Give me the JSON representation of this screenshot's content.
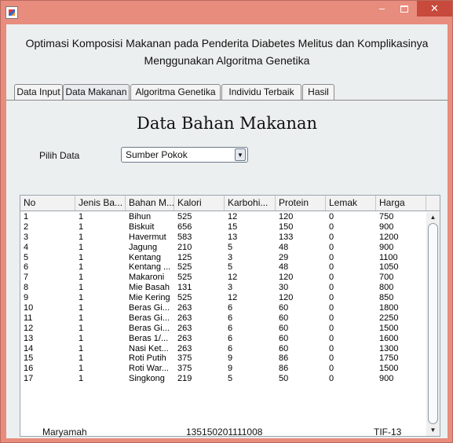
{
  "window": {
    "controls": {
      "minimize": "‒",
      "close": "✕"
    },
    "colors": {
      "titlebar": "#e88c7d",
      "close": "#c74a3c"
    }
  },
  "heading": {
    "line1": "Optimasi Komposisi Makanan pada Penderita Diabetes Melitus dan Komplikasinya",
    "line2": "Menggunakan Algoritma Genetika"
  },
  "tabs": [
    "Data Input",
    "Data Makanan",
    "Algoritma Genetika",
    "Individu Terbaik",
    "Hasil"
  ],
  "active_tab": "Data Makanan",
  "section_title": "Data Bahan Makanan",
  "filter": {
    "label": "Pilih Data",
    "selected": "Sumber Pokok"
  },
  "table": {
    "columns": [
      "No",
      "Jenis Ba...",
      "Bahan M...",
      "Kalori",
      "Karbohi...",
      "Protein",
      "Lemak",
      "Harga"
    ],
    "rows": [
      [
        "1",
        "1",
        "Bihun",
        "525",
        "12",
        "120",
        "0",
        "750"
      ],
      [
        "2",
        "1",
        "Biskuit",
        "656",
        "15",
        "150",
        "0",
        "900"
      ],
      [
        "3",
        "1",
        "Havermut",
        "583",
        "13",
        "133",
        "0",
        "1200"
      ],
      [
        "4",
        "1",
        "Jagung",
        "210",
        "5",
        "48",
        "0",
        "900"
      ],
      [
        "5",
        "1",
        "Kentang",
        "125",
        "3",
        "29",
        "0",
        "1100"
      ],
      [
        "6",
        "1",
        "Kentang ...",
        "525",
        "5",
        "48",
        "0",
        "1050"
      ],
      [
        "7",
        "1",
        "Makaroni",
        "525",
        "12",
        "120",
        "0",
        "700"
      ],
      [
        "8",
        "1",
        "Mie Basah",
        "131",
        "3",
        "30",
        "0",
        "800"
      ],
      [
        "9",
        "1",
        "Mie Kering",
        "525",
        "12",
        "120",
        "0",
        "850"
      ],
      [
        "10",
        "1",
        "Beras Gi...",
        "263",
        "6",
        "60",
        "0",
        "1800"
      ],
      [
        "11",
        "1",
        "Beras Gi...",
        "263",
        "6",
        "60",
        "0",
        "2250"
      ],
      [
        "12",
        "1",
        "Beras Gi...",
        "263",
        "6",
        "60",
        "0",
        "1500"
      ],
      [
        "13",
        "1",
        "Beras 1/...",
        "263",
        "6",
        "60",
        "0",
        "1600"
      ],
      [
        "14",
        "1",
        "Nasi Ket...",
        "263",
        "6",
        "60",
        "0",
        "1300"
      ],
      [
        "15",
        "1",
        "Roti Putih",
        "375",
        "9",
        "86",
        "0",
        "1750"
      ],
      [
        "16",
        "1",
        "Roti War...",
        "375",
        "9",
        "86",
        "0",
        "1500"
      ],
      [
        "17",
        "1",
        "Singkong",
        "219",
        "5",
        "50",
        "0",
        "900"
      ]
    ]
  },
  "footer": {
    "name": "Maryamah",
    "nim": "135150201111008",
    "class": "TIF-13"
  }
}
